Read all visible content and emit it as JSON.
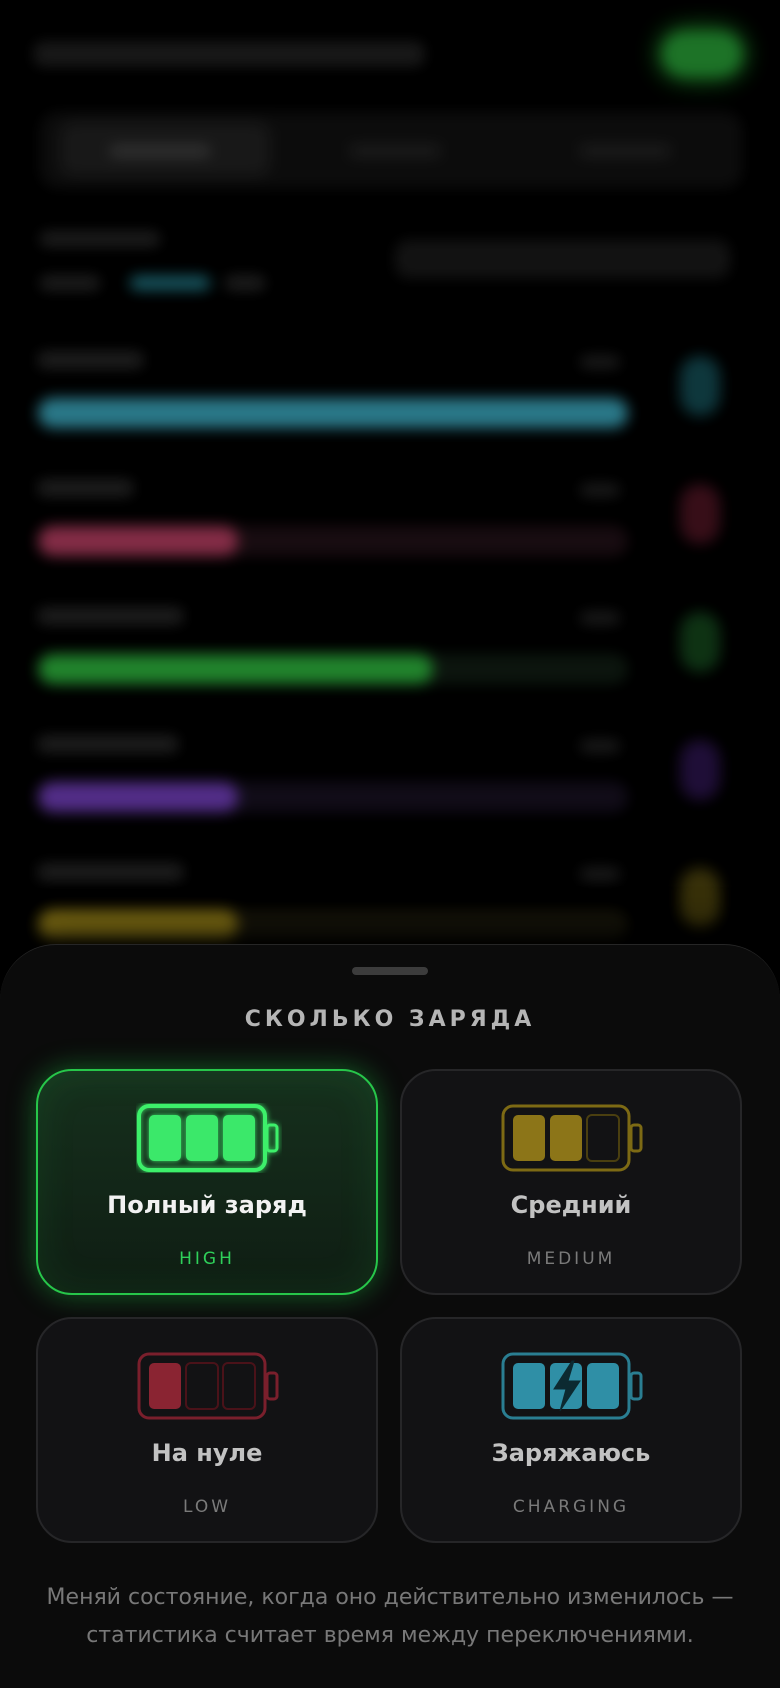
{
  "colors": {
    "cyan": "#3a9fb4",
    "pink": "#b03a5c",
    "green": "#2eae3e",
    "purple": "#6a3ab0",
    "yellow": "#a08a1a"
  },
  "sheet": {
    "title": "СКОЛЬКО ЗАРЯДА",
    "options": [
      {
        "label": "Полный заряд",
        "sub": "HIGH",
        "selected": true,
        "icon": "battery-full-icon",
        "color": "#2ee05a"
      },
      {
        "label": "Средний",
        "sub": "MEDIUM",
        "selected": false,
        "icon": "battery-medium-icon",
        "color": "#8c7518"
      },
      {
        "label": "На нуле",
        "sub": "LOW",
        "selected": false,
        "icon": "battery-low-icon",
        "color": "#8a2432"
      },
      {
        "label": "Заряжаюсь",
        "sub": "CHARGING",
        "selected": false,
        "icon": "battery-charging-icon",
        "color": "#2f8fa6"
      }
    ],
    "footnote": "Меняй состояние, когда оно действительно изменилось — статистика считает время между переключениями."
  }
}
